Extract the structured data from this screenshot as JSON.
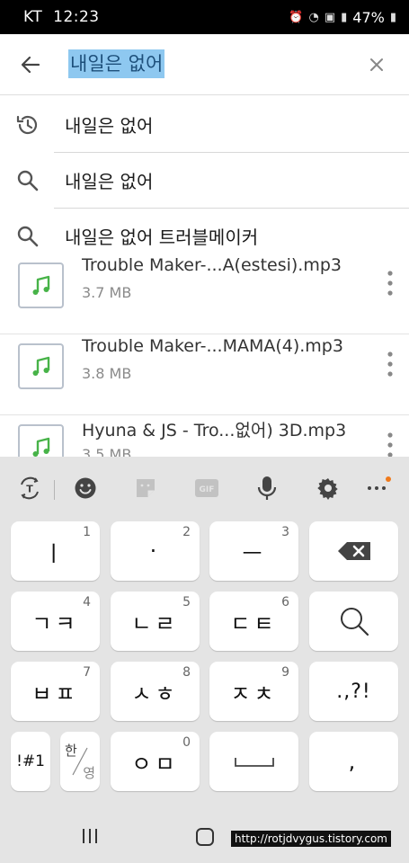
{
  "status_bar": {
    "carrier": "KT",
    "time": "12:23",
    "battery": "47%"
  },
  "search": {
    "query": "내일은 없어"
  },
  "suggestions": [
    {
      "icon": "history-icon",
      "text": "내일은 없어"
    },
    {
      "icon": "search-icon",
      "text": "내일은 없어"
    },
    {
      "icon": "search-icon",
      "text": "내일은 없어 트러블메이커"
    }
  ],
  "files": [
    {
      "name": "Trouble Maker-...A(estesi).mp3",
      "size": "3.7 MB"
    },
    {
      "name": "Trouble Maker-...MAMA(4).mp3",
      "size": "3.8 MB"
    },
    {
      "name": "Hyuna & JS - Tro...없어) 3D.mp3",
      "size": "3.5 MB"
    }
  ],
  "keyboard": {
    "rows": [
      [
        {
          "label": "ㅣ",
          "num": "1"
        },
        {
          "label": "·",
          "num": "2"
        },
        {
          "label": "ㅡ",
          "num": "3"
        },
        {
          "label": "backspace"
        }
      ],
      [
        {
          "label": "ㄱㅋ",
          "num": "4"
        },
        {
          "label": "ㄴㄹ",
          "num": "5"
        },
        {
          "label": "ㄷㅌ",
          "num": "6"
        },
        {
          "label": "search"
        }
      ],
      [
        {
          "label": "ㅂㅍ",
          "num": "7"
        },
        {
          "label": "ㅅㅎ",
          "num": "8"
        },
        {
          "label": "ㅈㅊ",
          "num": "9"
        },
        {
          "label": ".,?!"
        }
      ],
      [
        {
          "label": "!#1"
        },
        {
          "label": "한/영",
          "top": "한",
          "bottom": "영"
        },
        {
          "label": "ㅇㅁ",
          "num": "0"
        },
        {
          "label": "space"
        },
        {
          "label": ","
        }
      ]
    ],
    "toolbar": [
      "translate-icon",
      "emoji-icon",
      "sticker-icon",
      "gif-icon",
      "mic-icon",
      "settings-icon",
      "more-icon"
    ],
    "gif_label": "GIF"
  },
  "watermark": "http://rotjdvygus.tistory.com",
  "colors": {
    "accent_green": "#47b348",
    "selection": "#8ec8f0",
    "notif_dot": "#f07a1b"
  }
}
